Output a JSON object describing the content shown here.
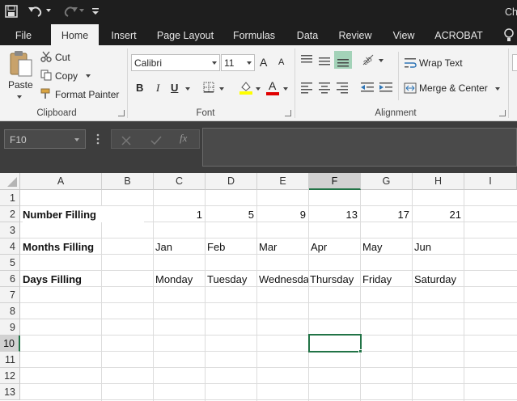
{
  "title_bar": {
    "title_fragment": "Ch"
  },
  "tabs": [
    "File",
    "Home",
    "Insert",
    "Page Layout",
    "Formulas",
    "Data",
    "Review",
    "View",
    "ACROBAT"
  ],
  "clipboard": {
    "paste": "Paste",
    "cut": "Cut",
    "copy": "Copy",
    "format_painter": "Format Painter",
    "group": "Clipboard"
  },
  "font": {
    "name": "Calibri",
    "size": "11",
    "bold": "B",
    "italic": "I",
    "underline": "U",
    "font_color_glyph": "A",
    "grow": "A",
    "shrink": "A",
    "group": "Font"
  },
  "alignment": {
    "wrap": "Wrap Text",
    "merge": "Merge & Center",
    "group": "Alignment"
  },
  "formula_bar": {
    "name_box": "F10",
    "fx": "fx",
    "value": ""
  },
  "columns": [
    "A",
    "B",
    "C",
    "D",
    "E",
    "F",
    "G",
    "H",
    "I"
  ],
  "active_column": "F",
  "rows": [
    "1",
    "2",
    "3",
    "4",
    "5",
    "6",
    "7",
    "8",
    "9",
    "10",
    "11",
    "12",
    "13"
  ],
  "active_row": "10",
  "sheet": {
    "r2": {
      "label": "Number Filling",
      "values": [
        "1",
        "5",
        "9",
        "13",
        "17",
        "21"
      ]
    },
    "r4": {
      "label": "Months Filling",
      "values": [
        "Jan",
        "Feb",
        "Mar",
        "Apr",
        "May",
        "Jun"
      ]
    },
    "r6": {
      "label": "Days Filling",
      "values": [
        "Monday",
        "Tuesday",
        "Wednesday",
        "Thursday",
        "Friday",
        "Saturday"
      ]
    }
  },
  "colors": {
    "accent": "#217346",
    "dark": "#1e1e1e",
    "ribbon": "#f3f3f3"
  }
}
